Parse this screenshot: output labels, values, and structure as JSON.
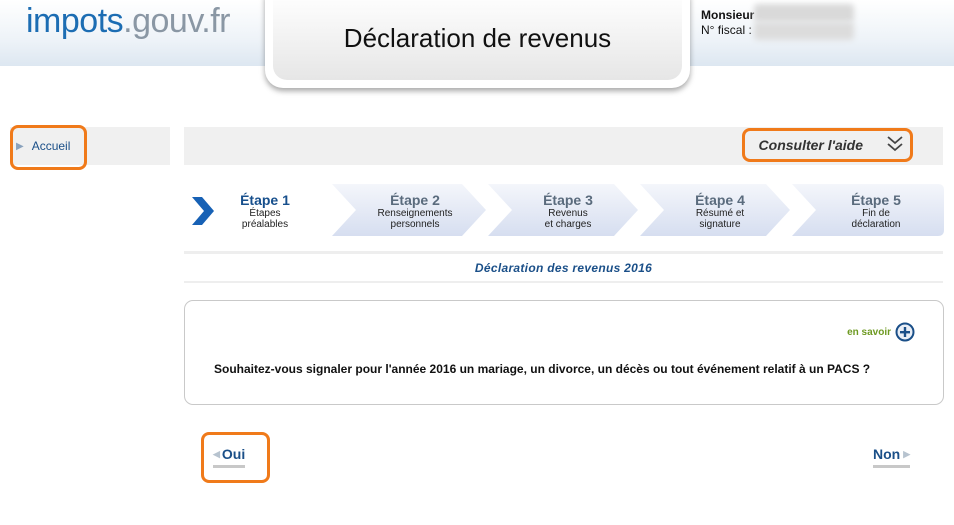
{
  "header": {
    "logo_part1": "impots",
    "logo_part2": ".gouv.fr",
    "title": "Déclaration de revenus",
    "user_name": "Monsieur",
    "fiscal_label": "N° fiscal :"
  },
  "sidebar": {
    "items": [
      {
        "label": "Accueil"
      }
    ]
  },
  "help": {
    "label": "Consulter l'aide",
    "icon": "double-chevron-down-icon"
  },
  "steps": [
    {
      "title": "Étape 1",
      "line1": "Étapes",
      "line2": "préalables",
      "active": true
    },
    {
      "title": "Étape 2",
      "line1": "Renseignements",
      "line2": "personnels",
      "active": false
    },
    {
      "title": "Étape 3",
      "line1": "Revenus",
      "line2": "et charges",
      "active": false
    },
    {
      "title": "Étape 4",
      "line1": "Résumé et",
      "line2": "signature",
      "active": false
    },
    {
      "title": "Étape 5",
      "line1": "Fin de",
      "line2": "déclaration",
      "active": false
    }
  ],
  "section_title": "Déclaration des revenus 2016",
  "question": {
    "more_label": "en savoir",
    "text": "Souhaitez-vous signaler pour l'année 2016 un mariage, un divorce, un décès ou tout événement relatif à un PACS ?"
  },
  "buttons": {
    "yes": "Oui",
    "no": "Non"
  },
  "colors": {
    "link_blue": "#1a4f88",
    "highlight_orange": "#f07a1a",
    "step_bg": "#dde4f2",
    "more_green": "#6e9a22"
  }
}
